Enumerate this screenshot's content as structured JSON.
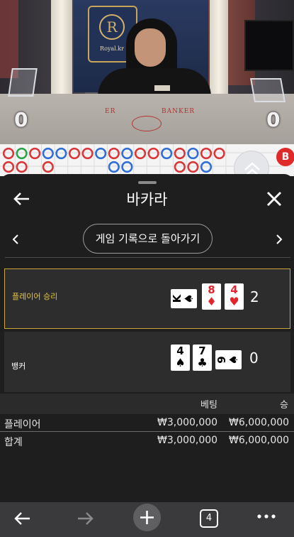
{
  "video": {
    "logo_letter": "R",
    "logo_text": "Royal.kr",
    "felt_player": "ER",
    "felt_banker": "BANKER",
    "player_score": "0",
    "banker_score": "0"
  },
  "road_badge": "B",
  "sheet": {
    "title": "바카라",
    "back_to_history": "게임 기록으로 돌아가기"
  },
  "hands": {
    "player": {
      "label": "플레이어 승리",
      "cards": [
        {
          "rank": "K",
          "suit": "♠",
          "color": "black",
          "rotated": true
        },
        {
          "rank": "8",
          "suit": "♦",
          "color": "red",
          "rotated": false
        },
        {
          "rank": "4",
          "suit": "♥",
          "color": "red",
          "rotated": false
        }
      ],
      "total": "2"
    },
    "banker": {
      "label": "뱅커",
      "cards": [
        {
          "rank": "4",
          "suit": "♠",
          "color": "black",
          "rotated": false
        },
        {
          "rank": "7",
          "suit": "♣",
          "color": "black",
          "rotated": false
        },
        {
          "rank": "9",
          "suit": "♠",
          "color": "black",
          "rotated": true
        }
      ],
      "total": "0"
    }
  },
  "bets": {
    "columns": {
      "bet": "베팅",
      "win": "승"
    },
    "rows": [
      {
        "label": "플레이어",
        "bet": "₩3,000,000",
        "win": "₩6,000,000"
      },
      {
        "label": "합계",
        "bet": "₩3,000,000",
        "win": "₩6,000,000"
      }
    ]
  },
  "toolbar": {
    "tab_count": "4"
  },
  "colors": {
    "player_accent": "#e3c349",
    "red_suit": "#e4242d",
    "sheet_bg": "#1e1e1e"
  }
}
